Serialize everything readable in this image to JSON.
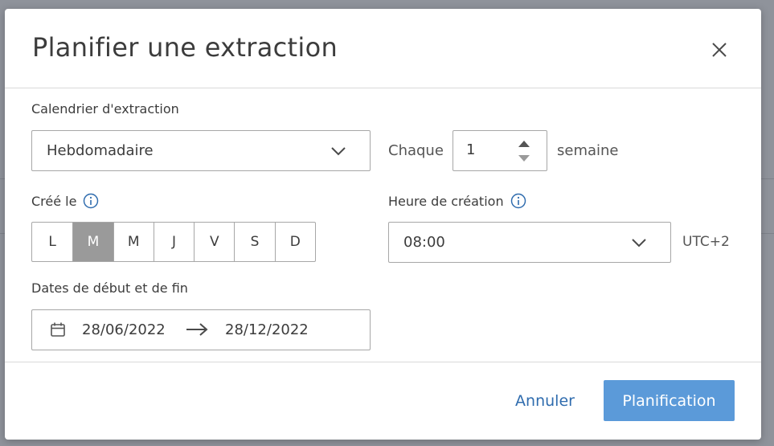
{
  "dialog": {
    "title": "Planifier une extraction",
    "close_icon": "close-icon"
  },
  "schedule": {
    "label": "Calendrier d'extraction",
    "frequency_value": "Hebdomadaire",
    "every_label": "Chaque",
    "interval_value": "1",
    "unit_label": "semaine"
  },
  "created": {
    "label": "Créé le",
    "days": [
      {
        "label": "L",
        "selected": false
      },
      {
        "label": "M",
        "selected": true
      },
      {
        "label": "M",
        "selected": false
      },
      {
        "label": "J",
        "selected": false
      },
      {
        "label": "V",
        "selected": false
      },
      {
        "label": "S",
        "selected": false
      },
      {
        "label": "D",
        "selected": false
      }
    ]
  },
  "time": {
    "label": "Heure de création",
    "value": "08:00",
    "timezone": "UTC+2"
  },
  "dates": {
    "label": "Dates de début et de fin",
    "start": "28/06/2022",
    "end": "28/12/2022"
  },
  "footer": {
    "cancel_label": "Annuler",
    "submit_label": "Planification"
  },
  "colors": {
    "accent": "#5b9ad9",
    "link": "#2f6cae",
    "selected_day": "#9a9a9a",
    "info_icon": "#2f6cae"
  }
}
